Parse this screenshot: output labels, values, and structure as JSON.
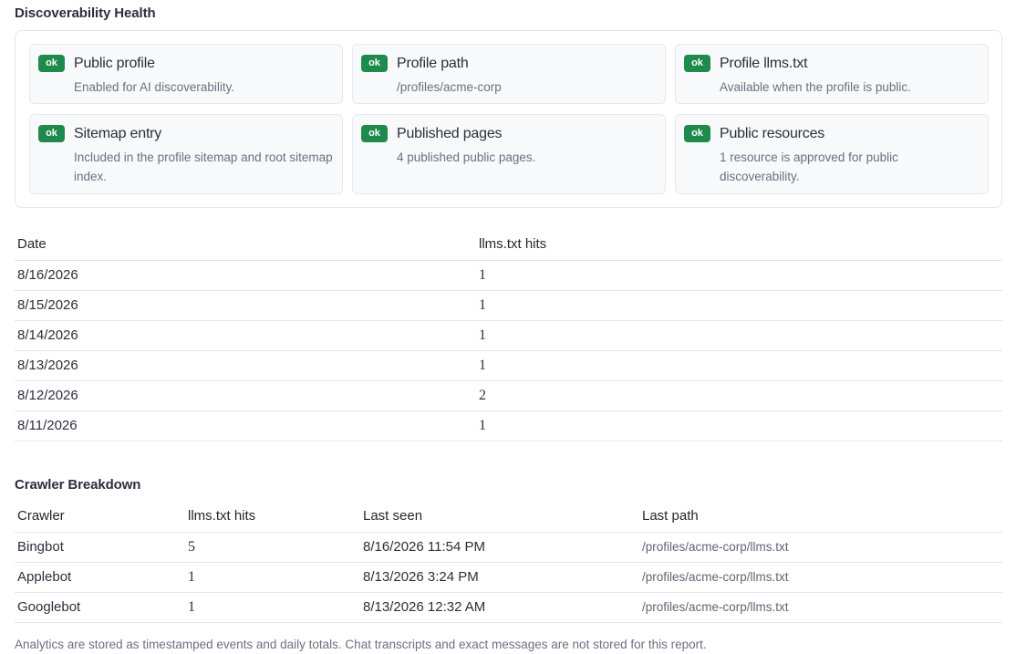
{
  "health": {
    "title": "Discoverability Health",
    "badge": "ok",
    "cards": [
      {
        "title": "Public profile",
        "desc": "Enabled for AI discoverability."
      },
      {
        "title": "Profile path",
        "desc": "/profiles/acme-corp"
      },
      {
        "title": "Profile llms.txt",
        "desc": "Available when the profile is public."
      },
      {
        "title": "Sitemap entry",
        "desc": "Included in the profile sitemap and root sitemap index."
      },
      {
        "title": "Published pages",
        "desc": "4 published public pages."
      },
      {
        "title": "Public resources",
        "desc": "1 resource is approved for public discoverability."
      }
    ],
    "success_color": "#1e8a4c"
  },
  "daily": {
    "headers": {
      "date": "Date",
      "hits": "llms.txt hits"
    },
    "rows": [
      {
        "date": "8/16/2026",
        "hits": "1"
      },
      {
        "date": "8/15/2026",
        "hits": "1"
      },
      {
        "date": "8/14/2026",
        "hits": "1"
      },
      {
        "date": "8/13/2026",
        "hits": "1"
      },
      {
        "date": "8/12/2026",
        "hits": "2"
      },
      {
        "date": "8/11/2026",
        "hits": "1"
      }
    ]
  },
  "crawlers": {
    "title": "Crawler Breakdown",
    "headers": {
      "crawler": "Crawler",
      "hits": "llms.txt hits",
      "last_seen": "Last seen",
      "last_path": "Last path"
    },
    "rows": [
      {
        "crawler": "Bingbot",
        "hits": "5",
        "last_seen": "8/16/2026 11:54 PM",
        "last_path": "/profiles/acme-corp/llms.txt"
      },
      {
        "crawler": "Applebot",
        "hits": "1",
        "last_seen": "8/13/2026 3:24 PM",
        "last_path": "/profiles/acme-corp/llms.txt"
      },
      {
        "crawler": "Googlebot",
        "hits": "1",
        "last_seen": "8/13/2026 12:32 AM",
        "last_path": "/profiles/acme-corp/llms.txt"
      }
    ]
  },
  "footnote": "Analytics are stored as timestamped events and daily totals. Chat transcripts and exact messages are not stored for this report."
}
